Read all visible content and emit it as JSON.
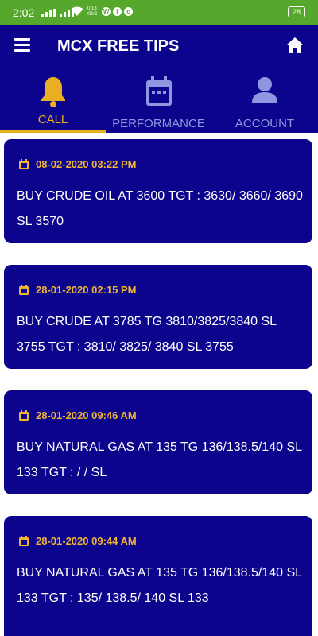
{
  "status_bar": {
    "time": "2:02",
    "net_speed": "0.13",
    "net_unit": "KB/S",
    "battery": "28",
    "app_icons": [
      "W",
      "f",
      "c"
    ]
  },
  "app_bar": {
    "title": "MCX FREE TIPS"
  },
  "tabs": [
    {
      "label": "CALL",
      "active": true,
      "icon": "bell-icon"
    },
    {
      "label": "PERFORMANCE",
      "active": false,
      "icon": "calendar-icon"
    },
    {
      "label": "ACCOUNT",
      "active": false,
      "icon": "person-icon"
    }
  ],
  "colors": {
    "primary": "#0c048c",
    "accent": "#e9ae21",
    "inactive_tab": "#8e97e0",
    "status_bar": "#55a82c"
  },
  "tips": [
    {
      "date": "08-02-2020 03:22 PM",
      "text": "BUY CRUDE OIL AT 3600 TGT : 3630/ 3660/ 3690 SL 3570"
    },
    {
      "date": "28-01-2020 02:15 PM",
      "text": "BUY CRUDE AT 3785 TG 3810/3825/3840 SL 3755 TGT : 3810/ 3825/ 3840 SL 3755"
    },
    {
      "date": "28-01-2020 09:46 AM",
      "text": "BUY NATURAL GAS AT 135 TG 136/138.5/140 SL 133 TGT : / / SL"
    },
    {
      "date": "28-01-2020 09:44 AM",
      "text": "BUY NATURAL GAS AT 135 TG 136/138.5/140 SL 133 TGT : 135/ 138.5/ 140 SL 133"
    }
  ]
}
